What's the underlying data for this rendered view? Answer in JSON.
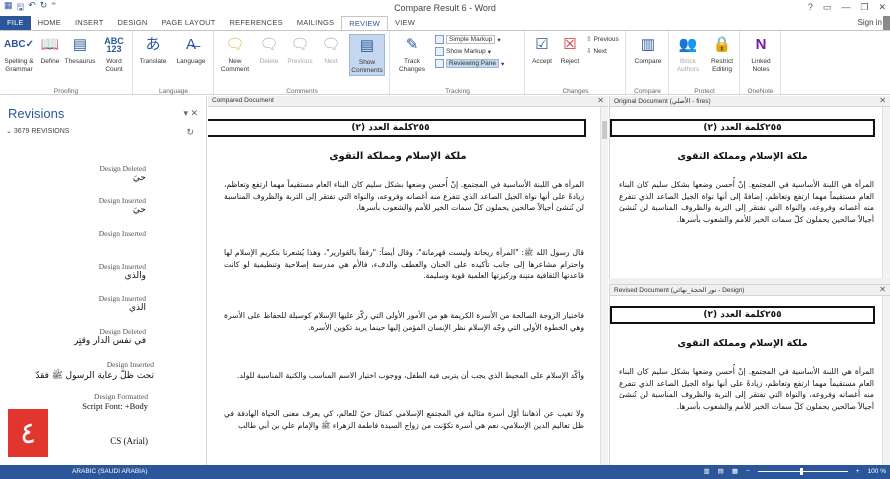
{
  "title_bar": {
    "title": "Compare Result 6 - Word",
    "help": "?",
    "min": "—",
    "restore": "❐",
    "close": "✕"
  },
  "tabs": [
    "FILE",
    "HOME",
    "INSERT",
    "DESIGN",
    "PAGE LAYOUT",
    "REFERENCES",
    "MAILINGS",
    "REVIEW",
    "VIEW"
  ],
  "active_tab": "REVIEW",
  "sign_in": "Sign in",
  "ribbon": {
    "proofing": {
      "label": "Proofing",
      "spelling": "Spelling & Grammar",
      "define": "Define",
      "thesaurus": "Thesaurus",
      "word_count": "Word Count"
    },
    "language": {
      "label": "Language",
      "translate": "Translate",
      "language": "Language"
    },
    "comments": {
      "label": "Comments",
      "new": "New Comment",
      "delete": "Delete",
      "previous": "Previous",
      "next": "Next",
      "show": "Show Comments"
    },
    "tracking": {
      "label": "Tracking",
      "track": "Track Changes",
      "simple_markup": "Simple Markup",
      "show_markup": "Show Markup",
      "reviewing_pane": "Reviewing Pane"
    },
    "changes": {
      "label": "Changes",
      "accept": "Accept",
      "reject": "Reject",
      "previous": "Previous",
      "next": "Next"
    },
    "compare": {
      "label": "Compare",
      "compare": "Compare"
    },
    "protect": {
      "label": "Protect",
      "block": "Block Authors",
      "restrict": "Restrict Editing"
    },
    "onenote": {
      "label": "OneNote",
      "linked": "Linked Notes"
    }
  },
  "revisions": {
    "title": "Revisions",
    "count": "3679 REVISIONS",
    "items": [
      {
        "type": "Design Deleted",
        "text": "حيَ"
      },
      {
        "type": "Design Inserted",
        "text": "حيَ"
      },
      {
        "type": "Design Inserted",
        "text": ""
      },
      {
        "type": "Design Inserted",
        "text": "والذي"
      },
      {
        "type": "Design Inserted",
        "text": "الذي"
      },
      {
        "type": "Design Deleted",
        "text": "في نفس الدار وقتٍر"
      },
      {
        "type": "Design Inserted",
        "text": "تحت ظلّ رعاية الرسول ﷺ فقدّ"
      },
      {
        "type": "Design Formatted",
        "text": "Script Font: +Body"
      },
      {
        "type": "",
        "text": "CS (Arial)"
      }
    ],
    "badge": "٤"
  },
  "compared": {
    "header": "Compared Document",
    "issue": "٢٥٥كلمة العدد (٢)",
    "article_title": "ملكة الإسلام ومملكة التقوى",
    "paragraphs": [
      "المرأة هي اللبنة الأساسية في المجتمع. إنْ أُحسن وضعها بشكل سليم كان البناء العام مستقيماً مهما ارتفع وتعاظم، زيادةً على أنها نواة الجيل الصاعد الذي تتفرع منه أغصانه وفروعه، والنواة التي تفتقر إلى التربة والظروف المناسبة لن تُنشئ أجيالاً صالحين يحملون كلّ سمات الخير للأمم والشعوب بأسرها.",
      "قال رسول الله ﷺ: \"المرأة ريحانة وليست قهرمانة\"، وقال أيضاً: \"رفقاً بالقوارير\"، وهذا يُشعرنا بتكريم الإسلام لها واحترام مشاعرها إلى جانب تأكيده على الحنان والعطف والدفء، فالأم هي مدرسة إصلاحية وتنظيمية لو كانت قاعدتها الثقافية متينة وركيزتها العلمية قوية وسليمة.",
      "فاختيار الزوجة الصالحة من الأسرة الكريمة هو من الأمور الأولى التي ركّز عليها الإسلام كوسيلة للحفاظ على الأسرة وهي الخطوة الأولى التي وجّه الإسلام نظر الإنسان المؤمن إليها حينما يريد تكوين الأسرة.",
      "وأكّد الإسلام على المحيط الذي يجب أن يتربى فيه الطفل، ووجوب اختيار الاسم المناسب والكنية المناسبة للولد.",
      "ولا تغيب عن أذهاننا أوّل أسرة مثالية في المجتمع الإسلامي كمثال حيّ للعالم، كي يعرف معنى الحياة الهادفة في ظل تعاليم الدين الإسلامي، نعم هي أسرة تكوّنت من زواج السيدة فاطمة الزهراء ﷺ والإمام علي بن أبي طالب"
    ]
  },
  "original": {
    "header": "Original Document (الأصلي - fires)",
    "issue": "٢٥٥كلمة العدد (٢)",
    "article_title": "ملكة الإسلام ومملكة التقوى",
    "paragraph": "المرأة هي اللبنة الأساسية في المجتمع. إنْ أُحسن وضعها بشكل سليم كان البناء العام مستقيماً مهما ارتفع وتعاظم، إضافةً إلى أنها نواة الجيل الصاعد الذي تتفرع منه أغصانه وفروعه، والنواة التي تفتقر إلى التربة والظروف المناسبة لن تُنشئ أجيالاً صالحين يحملون كلّ سمات الخير للأمم والشعوب بأسرها."
  },
  "revised": {
    "header": "Revised Document (نور الحجة_نهائي - Design)",
    "issue": "٢٥٥كلمة العدد (٢)",
    "article_title": "ملكة الإسلام ومملكة التقوى",
    "paragraph": "المرأة هي اللبنة الأساسية في المجتمع. إنْ أُحسن وضعها بشكل سليم كان البناء العام مستقيماً مهما ارتفع وتعاظم، زيادةً على أنها نواة الجيل الصاعد الذي تتفرع منه أغصانه وفروعه، والنواة التي تفتقر إلى التربة والظروف المناسبة لن تُنشئ أجيالاً صالحين يحملون كلّ سمات الخير للأمم والشعوب بأسرها."
  },
  "status": {
    "language": "ARABIC (SAUDI ARABIA)",
    "zoom": "100 %",
    "zoom_minus": "−",
    "zoom_plus": "+"
  },
  "colors": {
    "accent": "#2b579a",
    "revision_bar": "#cc0000",
    "badge": "#e0362e"
  }
}
